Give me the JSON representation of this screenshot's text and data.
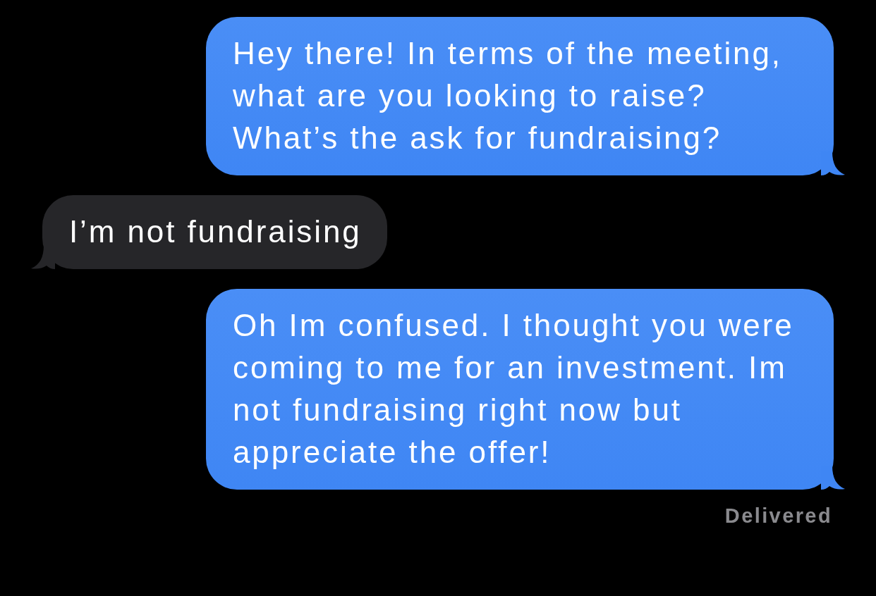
{
  "messages": [
    {
      "kind": "sent",
      "text": "Hey there! In terms of the meeting, what are you looking to raise? What’s the ask for fundraising?"
    },
    {
      "kind": "received",
      "text": "I’m not fundraising"
    },
    {
      "kind": "sent",
      "text": "Oh Im confused. I thought you were coming to me for an investment. Im not fundraising right now but appreciate the offer!"
    }
  ],
  "delivery_status": "Delivered"
}
